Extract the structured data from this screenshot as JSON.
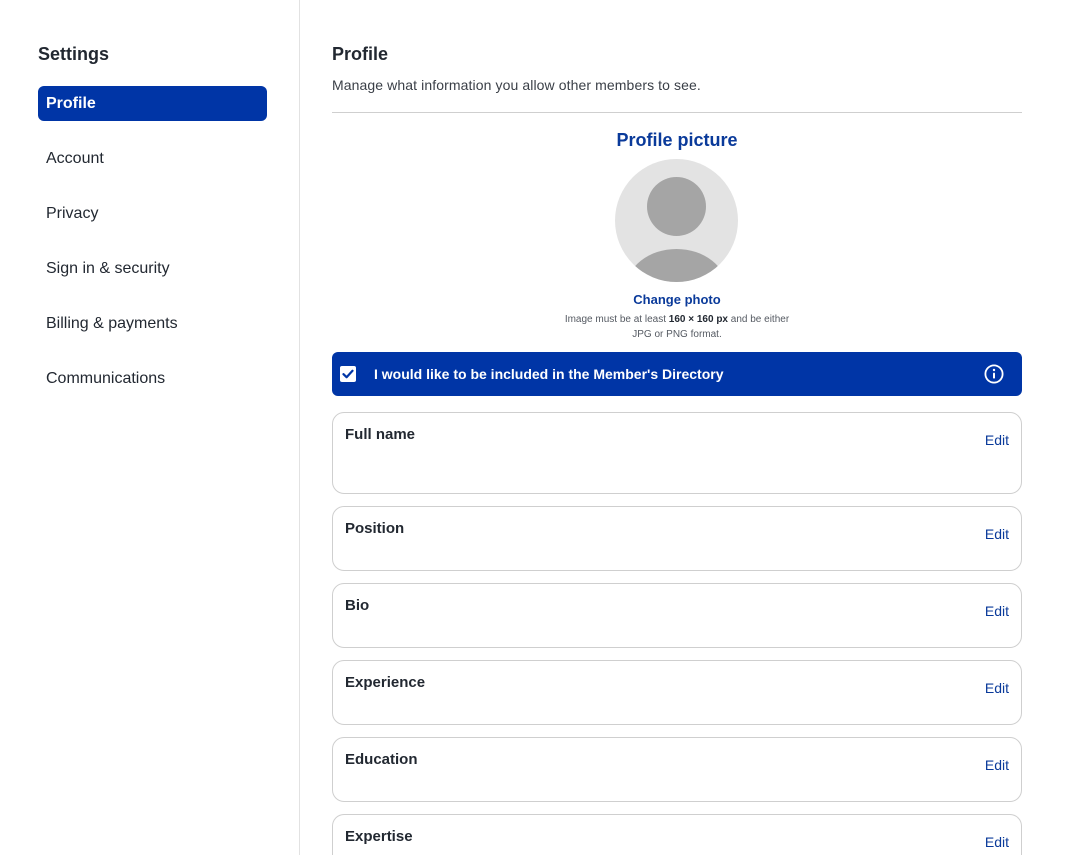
{
  "sidebar": {
    "title": "Settings",
    "items": [
      {
        "label": "Profile",
        "active": true
      },
      {
        "label": "Account"
      },
      {
        "label": "Privacy"
      },
      {
        "label": "Sign in & security"
      },
      {
        "label": "Billing & payments"
      },
      {
        "label": "Communications"
      }
    ]
  },
  "main": {
    "title": "Profile",
    "subtitle": "Manage what information you allow other members to see.",
    "picture": {
      "title": "Profile picture",
      "change_label": "Change photo",
      "hint_prefix": "Image must be at least ",
      "hint_size": "160 × 160 px",
      "hint_mid": " and be either",
      "hint_line2": "JPG or PNG format."
    },
    "directory": {
      "label": "I would like to be included in the Member's Directory",
      "checked": true
    },
    "fields": [
      {
        "label": "Full name",
        "edit": "Edit"
      },
      {
        "label": "Position",
        "edit": "Edit"
      },
      {
        "label": "Bio",
        "edit": "Edit"
      },
      {
        "label": "Experience",
        "edit": "Edit"
      },
      {
        "label": "Education",
        "edit": "Edit"
      },
      {
        "label": "Expertise",
        "edit": "Edit"
      }
    ]
  },
  "colors": {
    "accent": "#0035a6",
    "link": "#0a3a9a",
    "avatar_bg": "#e3e3e3",
    "avatar_fg": "#a5a5a5"
  }
}
